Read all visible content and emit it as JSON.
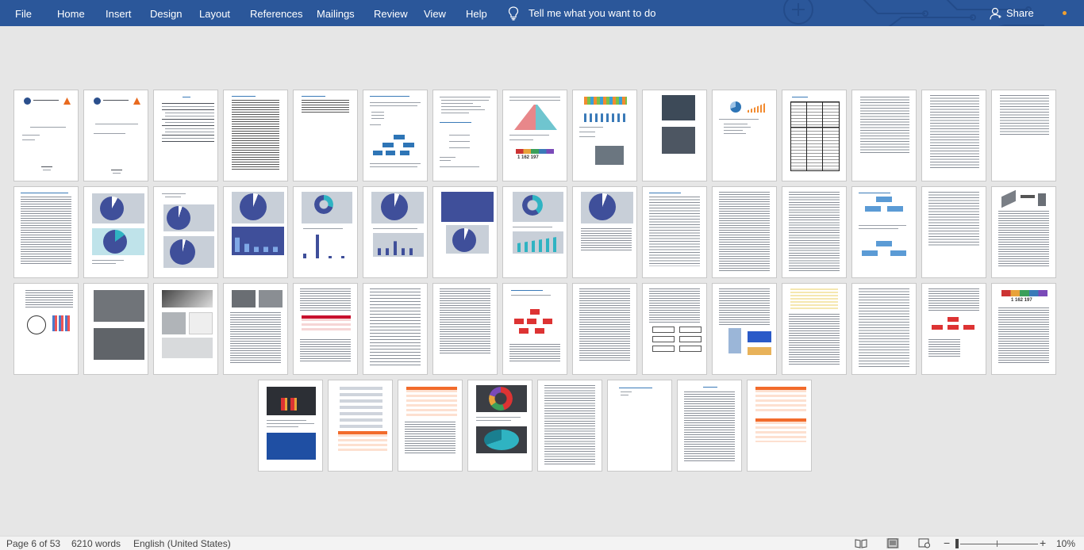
{
  "ribbon": {
    "tabs": [
      "File",
      "Home",
      "Insert",
      "Design",
      "Layout",
      "References",
      "Mailings",
      "Review",
      "View",
      "Help"
    ],
    "tell_me": "Tell me what you want to do",
    "share": "Share",
    "tell_icon": "lightbulb-icon",
    "share_icon": "person-icon"
  },
  "document": {
    "chart_number": "1 162 197"
  },
  "status": {
    "page": "Page 6 of 53",
    "words": "6210 words",
    "language": "English (United States)",
    "zoom": "10%",
    "minus": "−",
    "plus": "+"
  },
  "colors": {
    "ribbon": "#2b579a",
    "canvas": "#e6e6e6",
    "chart_blue": "#3f4f9a",
    "orange": "#f26b2b",
    "red": "#c8102e"
  }
}
